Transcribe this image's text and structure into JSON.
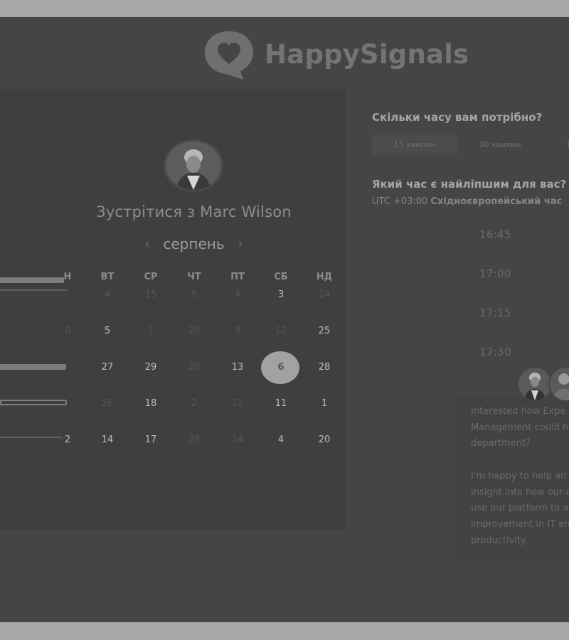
{
  "brand": {
    "name": "HappySignals",
    "logo_icon": "heart-speech-bubble-icon"
  },
  "meeting": {
    "title": "Зустрітися з Marc Wilson",
    "host_avatar": "host-avatar"
  },
  "calendar": {
    "month": "серпень",
    "prev_icon": "chevron-left-icon",
    "next_icon": "chevron-right-icon",
    "weekdays": [
      "Н",
      "ВТ",
      "СР",
      "ЧТ",
      "ПТ",
      "СБ",
      "НД"
    ],
    "rows": [
      [
        "",
        "4",
        "15",
        "9",
        "4",
        "3",
        "14"
      ],
      [
        "0",
        "5",
        "7",
        "20",
        "3",
        "12",
        "25"
      ],
      [
        "",
        "27",
        "29",
        "20",
        "13",
        "6",
        "28"
      ],
      [
        "",
        "26",
        "18",
        "2",
        "12",
        "11",
        "1"
      ],
      [
        "2",
        "14",
        "17",
        "28",
        "24",
        "4",
        "20"
      ]
    ],
    "selected_day": "6"
  },
  "duration": {
    "question": "Скільки часу вам потрібно?",
    "options": [
      "15 хвилин",
      "30 хвилин",
      "1"
    ]
  },
  "time": {
    "question": "Який час є найліпшим для вас?",
    "timezone_offset": "UTC +03:00",
    "timezone_name": "Східноєвропейський час",
    "slots": [
      "16:45",
      "17:00",
      "17:15",
      "17:30"
    ]
  },
  "chat": {
    "message": "Interested how Expe\nManagement could h\ndepartment?\n\nI'm happy to help an\ninsight into how our c\nuse our platform to a\nimprovement in IT en\nproductivity."
  },
  "colors": {
    "background": "#454545",
    "panel": "#3f3f3f",
    "selected": "#a2a2a2"
  }
}
